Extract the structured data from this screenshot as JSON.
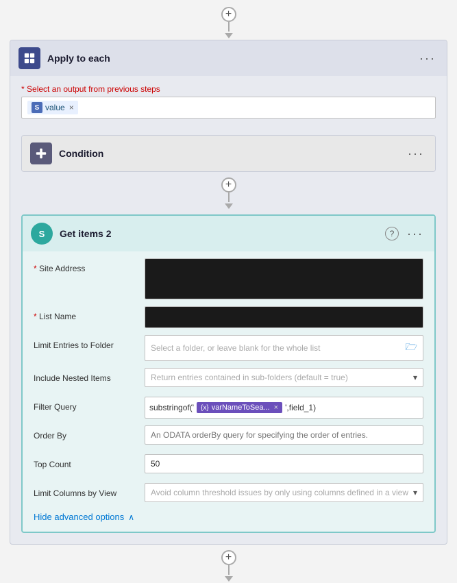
{
  "page": {
    "background": "#f3f3f3"
  },
  "top_connector": {
    "plus_label": "+",
    "arrow": "▼"
  },
  "apply_each": {
    "title": "Apply to each",
    "more_label": "···",
    "select_label": "Select an output from previous steps",
    "token": {
      "icon_label": "S",
      "text": "value",
      "close": "×"
    }
  },
  "condition": {
    "title": "Condition",
    "more_label": "···"
  },
  "middle_connector": {
    "plus_label": "+",
    "arrow": "▼"
  },
  "get_items": {
    "title": "Get items 2",
    "more_label": "···",
    "help_label": "?",
    "site_address": {
      "label": "Site Address",
      "value": ""
    },
    "list_name": {
      "label": "List Name",
      "value": ""
    },
    "limit_entries": {
      "label": "Limit Entries to Folder",
      "placeholder": "Select a folder, or leave blank for the whole list"
    },
    "include_nested": {
      "label": "Include Nested Items",
      "placeholder": "Return entries contained in sub-folders (default = true)"
    },
    "filter_query": {
      "label": "Filter Query",
      "prefix": "substringof('",
      "token_text": "varNameToSea...",
      "suffix": "',field_1)",
      "token_close": "×"
    },
    "order_by": {
      "label": "Order By",
      "placeholder": "An ODATA orderBy query for specifying the order of entries."
    },
    "top_count": {
      "label": "Top Count",
      "value": "50"
    },
    "limit_columns": {
      "label": "Limit Columns by View",
      "placeholder": "Avoid column threshold issues by only using columns defined in a view"
    },
    "advanced_link": "Hide advanced options",
    "chevron_up": "∧"
  },
  "bottom_connector": {
    "plus_label": "+",
    "arrow": "▼"
  }
}
